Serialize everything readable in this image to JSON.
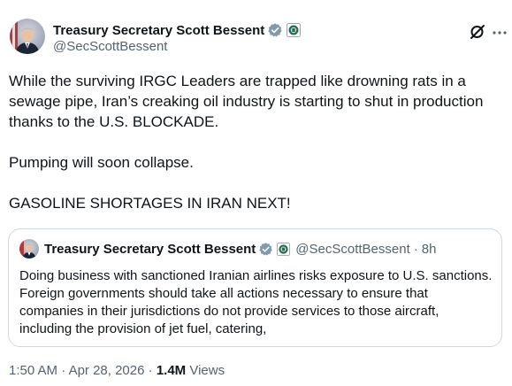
{
  "post": {
    "author": {
      "display_name": "Treasury Secretary Scott Bessent",
      "handle": "@SecScottBessent",
      "verified_badge": "verified-checkmark-icon",
      "affiliate_badge": "treasury-seal-icon"
    },
    "body": [
      "While the surviving IRGC Leaders are trapped like drowning rats in a sewage pipe, Iran’s creaking oil industry is starting to shut in production thanks to the U.S. BLOCKADE.",
      "Pumping will soon collapse.",
      "GASOLINE SHORTAGES IN IRAN NEXT!"
    ],
    "time": "1:50 AM",
    "separator": "·",
    "date": "Apr 28, 2026",
    "views_count": "1.4M",
    "views_label": "Views"
  },
  "quote": {
    "display_name": "Treasury Secretary Scott Bessent",
    "handle": "@SecScottBessent",
    "separator": "·",
    "time_ago": "8h",
    "text": "Doing business with sanctioned Iranian airlines risks exposure to U.S. sanctions.  Foreign governments should take all actions necessary to ensure that companies in their jurisdictions do not provide services to those aircraft, including the provision of jet fuel, catering,"
  },
  "icons": {
    "grok": "grok-icon",
    "more": "more-icon"
  },
  "colors": {
    "text_primary": "#0f1419",
    "text_secondary": "#536471",
    "verified_blue": "#829aab",
    "border": "#cfd9de",
    "seal_green": "#1f6e5b"
  }
}
